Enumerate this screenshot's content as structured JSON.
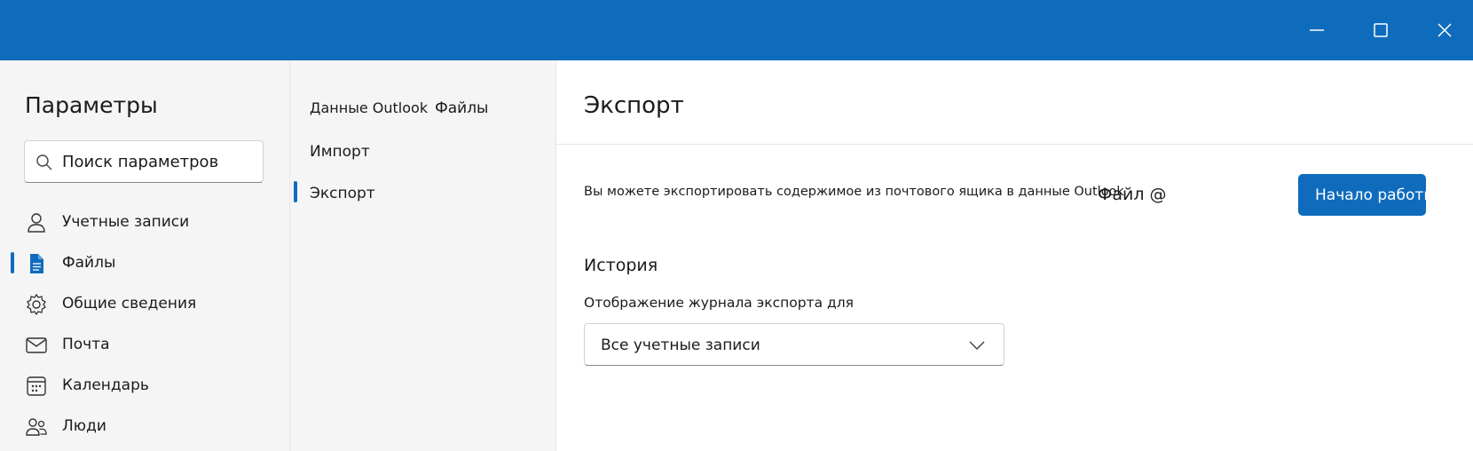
{
  "window": {
    "minimize": "minimize-icon",
    "maximize": "maximize-icon",
    "close": "close-icon"
  },
  "nav": {
    "title": "Параметры",
    "search_placeholder": "Поиск параметров",
    "items": [
      {
        "label": "Учетные записи",
        "icon": "person-icon"
      },
      {
        "label": "Файлы",
        "icon": "document-icon",
        "selected": true
      },
      {
        "label": "Общие сведения",
        "icon": "gear-icon"
      },
      {
        "label": "Почта",
        "icon": "mail-icon"
      },
      {
        "label": "Календарь",
        "icon": "calendar-icon"
      },
      {
        "label": "Люди",
        "icon": "people-icon"
      }
    ]
  },
  "subnav": {
    "header": "Данные Outlook",
    "header_suffix": "Файлы",
    "items": [
      {
        "label": "Импорт"
      },
      {
        "label": "Экспорт",
        "selected": true
      }
    ]
  },
  "content": {
    "title": "Экспорт",
    "description": "Вы можете экспортировать содержимое из почтового ящика в данные Outlook",
    "file_label": "Файл @",
    "start_button": "Начало работы",
    "history_title": "История",
    "history_label": "Отображение журнала экспорта для",
    "history_select_value": "Все учетные записи"
  },
  "colors": {
    "accent": "#0f6cbd",
    "nav_bg": "#f5f5f5"
  }
}
